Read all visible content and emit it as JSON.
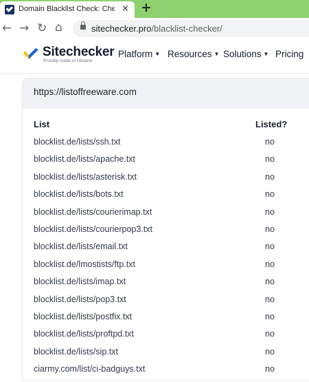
{
  "browser": {
    "tab_title": "Domain Blacklist Check: Check if",
    "tab_close": "×",
    "new_tab": "+",
    "url_host": "sitechecker.pro",
    "url_path": "/blacklist-checker/"
  },
  "header": {
    "brand": "Sitechecker",
    "tagline": "Proudly made in Ukraine",
    "nav": [
      {
        "label": "Platform"
      },
      {
        "label": "Resources"
      },
      {
        "label": "Solutions"
      },
      {
        "label": "Pricing"
      }
    ]
  },
  "result": {
    "domain": "https://listoffreeware.com",
    "columns": {
      "list": "List",
      "listed": "Listed?"
    },
    "rows": [
      {
        "list": "blocklist.de/lists/ssh.txt",
        "listed": "no"
      },
      {
        "list": "blocklist.de/lists/apache.txt",
        "listed": "no"
      },
      {
        "list": "blocklist.de/lists/asterisk.txt",
        "listed": "no"
      },
      {
        "list": "blocklist.de/lists/bots.txt",
        "listed": "no"
      },
      {
        "list": "blocklist.de/lists/courierimap.txt",
        "listed": "no"
      },
      {
        "list": "blocklist.de/lists/courierpop3.txt",
        "listed": "no"
      },
      {
        "list": "blocklist.de/lists/email.txt",
        "listed": "no"
      },
      {
        "list": "blocklist.de/lmostists/ftp.txt",
        "listed": "no"
      },
      {
        "list": "blocklist.de/lists/imap.txt",
        "listed": "no"
      },
      {
        "list": "blocklist.de/lists/pop3.txt",
        "listed": "no"
      },
      {
        "list": "blocklist.de/lists/postfix.txt",
        "listed": "no"
      },
      {
        "list": "blocklist.de/lists/proftpd.txt",
        "listed": "no"
      },
      {
        "list": "blocklist.de/lists/sip.txt",
        "listed": "no"
      },
      {
        "list": "ciarmy.com/list/ci-badguys.txt",
        "listed": "no"
      }
    ]
  },
  "colors": {
    "tabstrip": "#8fd070",
    "logo_blue": "#1f63d6",
    "logo_yellow": "#f6c21a"
  }
}
